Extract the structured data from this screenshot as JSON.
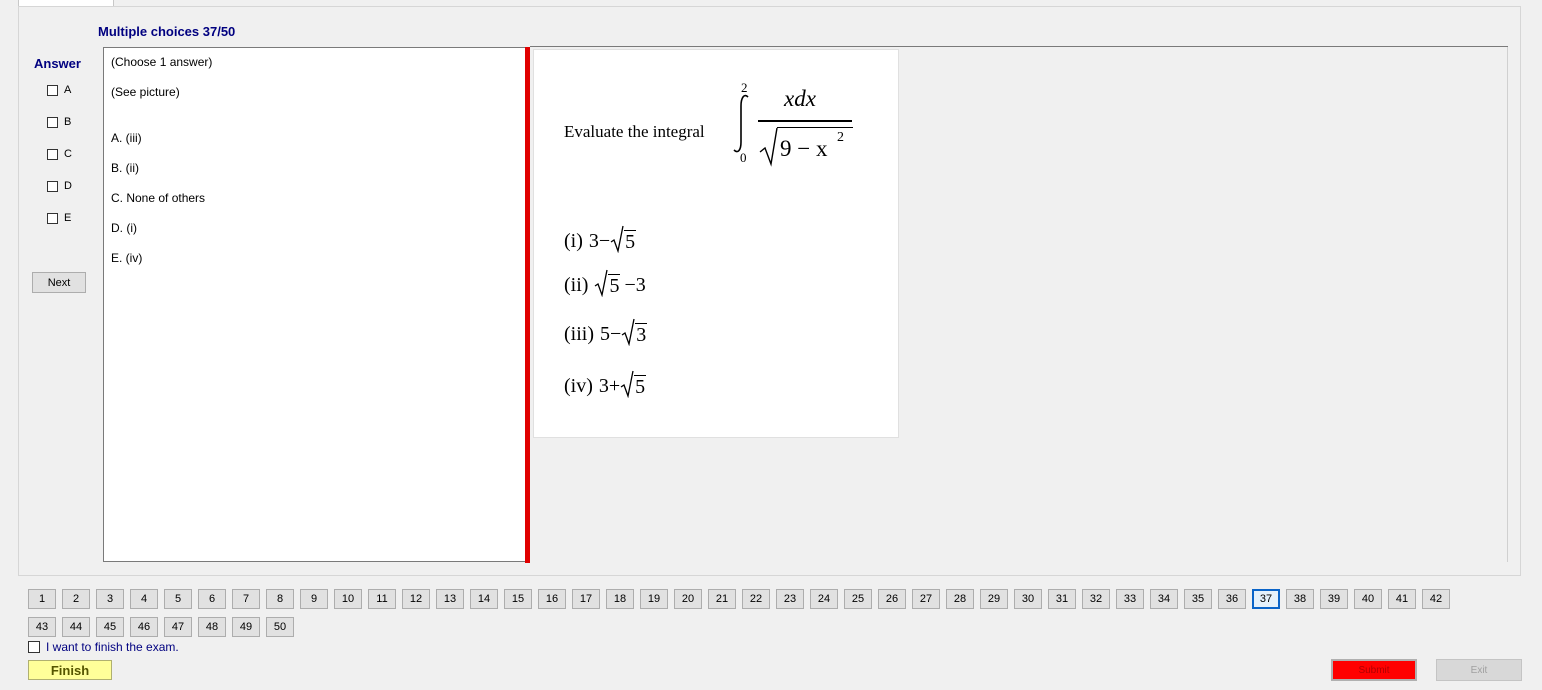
{
  "exam": {
    "title": "Multiple choices 37/50",
    "answer_label": "Answer",
    "options": [
      "A",
      "B",
      "C",
      "D",
      "E"
    ],
    "next_label": "Next"
  },
  "question": {
    "lines": [
      "(Choose 1 answer)",
      "(See picture)"
    ],
    "choices": [
      "A. (iii)",
      "B. (ii)",
      "C. None of others",
      "D. (i)",
      "E. (iv)"
    ]
  },
  "picture": {
    "prompt": "Evaluate the integral",
    "upper_limit": "2",
    "lower_limit": "0",
    "numerator": "xdx",
    "radicand": "9 − x",
    "exponent": "2",
    "items": [
      {
        "label": "(i)",
        "expr_before": "3−",
        "radicand": "5",
        "expr_after": ""
      },
      {
        "label": "(ii)",
        "expr_before": "",
        "radicand": "5",
        "expr_after": "−3"
      },
      {
        "label": "(iii)",
        "expr_before": "5−",
        "radicand": "3",
        "expr_after": ""
      },
      {
        "label": "(iv)",
        "expr_before": "3+",
        "radicand": "5",
        "expr_after": ""
      }
    ]
  },
  "navigation": {
    "numbers": [
      "1",
      "2",
      "3",
      "4",
      "5",
      "6",
      "7",
      "8",
      "9",
      "10",
      "11",
      "12",
      "13",
      "14",
      "15",
      "16",
      "17",
      "18",
      "19",
      "20",
      "21",
      "22",
      "23",
      "24",
      "25",
      "26",
      "27",
      "28",
      "29",
      "30",
      "31",
      "32",
      "33",
      "34",
      "35",
      "36",
      "37",
      "38",
      "39",
      "40",
      "41",
      "42",
      "43",
      "44",
      "45",
      "46",
      "47",
      "48",
      "49",
      "50"
    ],
    "current": "37"
  },
  "footer": {
    "finish_checkbox_label": "I want to finish the exam.",
    "finish_label": "Finish",
    "submit_label": "Submit",
    "exit_label": "Exit"
  },
  "colors": {
    "title": "#000080",
    "splitter": "#e00000",
    "submit": "#ff0000",
    "finish": "#ffff99",
    "active_number": "#0a64c8"
  }
}
